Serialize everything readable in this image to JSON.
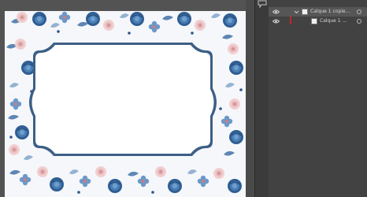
{
  "layers_panel": {
    "layers": [
      {
        "name": "Calque 1 copie...",
        "selected": true,
        "expanded": true
      },
      {
        "name": "Calque 1 ...",
        "selected": false
      }
    ]
  },
  "colors": {
    "workspace": "#535353",
    "panel": "#424242",
    "selected_row": "#565656",
    "marker": "#c8232c",
    "frame_stroke": "#3d5f86",
    "frame_fill": "#ffffff"
  },
  "icons": {
    "visibility": "eye-icon",
    "expand": "chevron-down-icon",
    "target": "circle-target-icon"
  }
}
